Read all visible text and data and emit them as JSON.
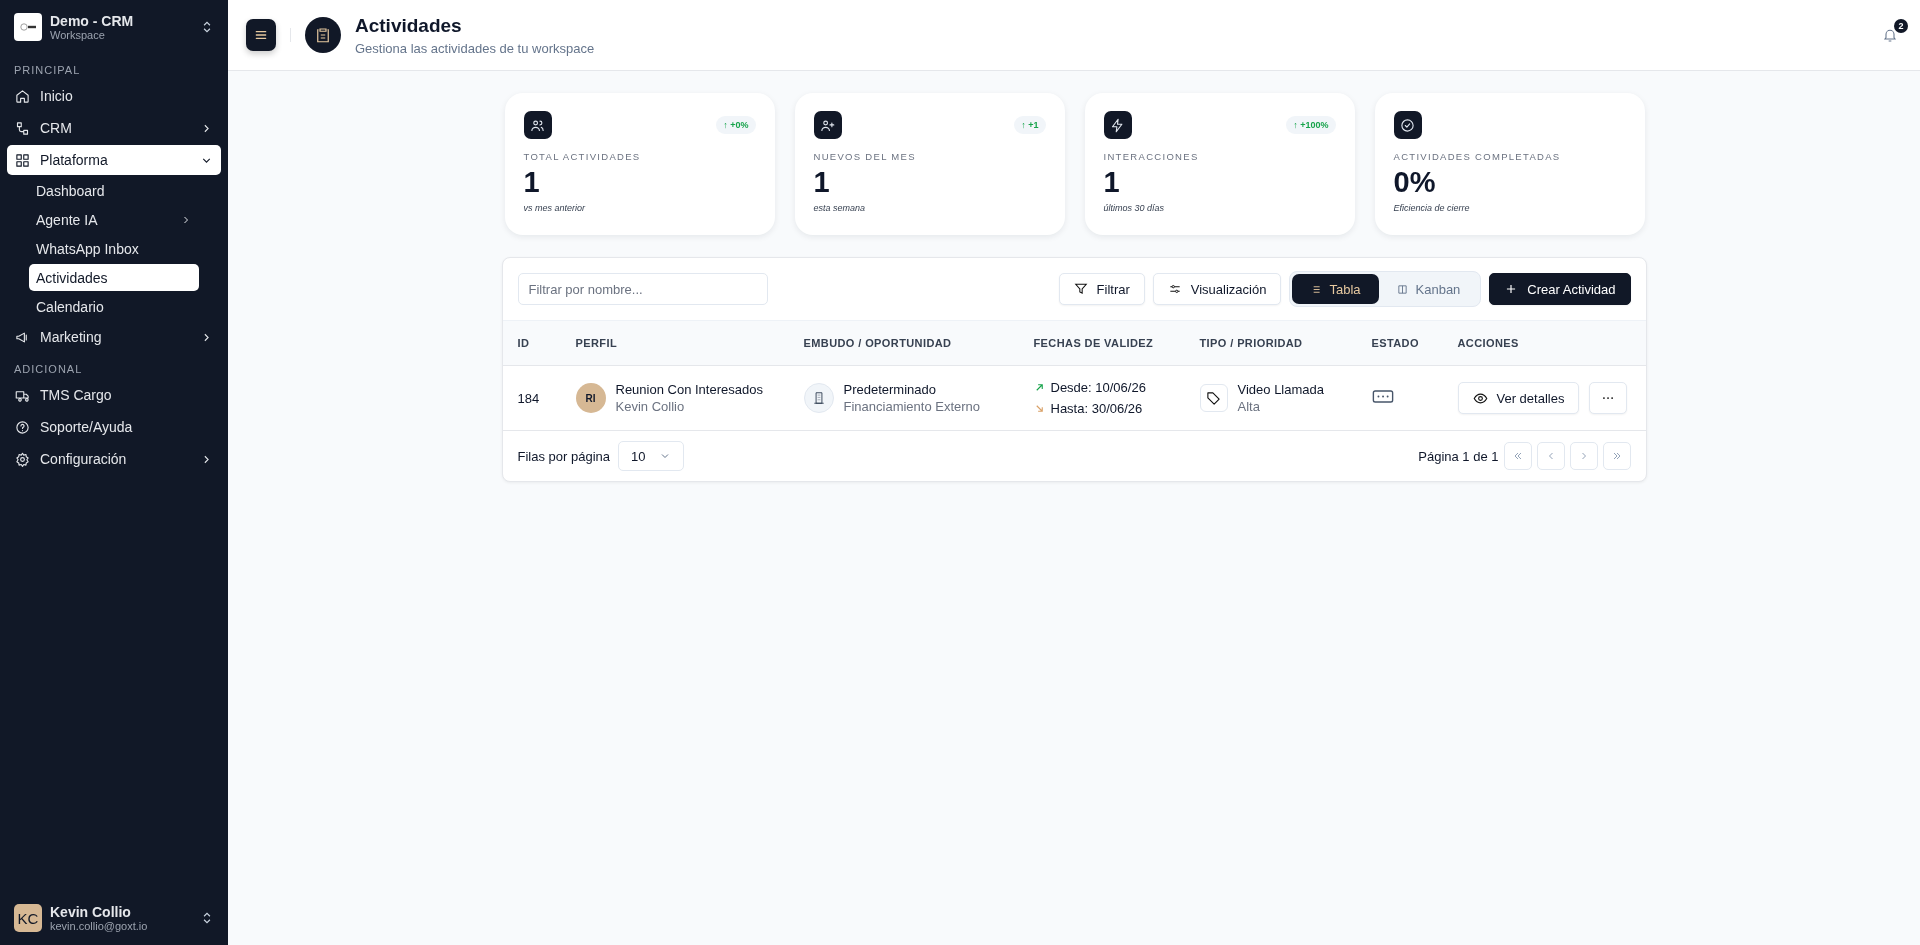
{
  "sidebar": {
    "workspace": {
      "name": "Demo - CRM",
      "sub": "Workspace"
    },
    "sections": [
      {
        "label": "PRINCIPAL",
        "items": [
          {
            "label": "Inicio",
            "selected": false
          },
          {
            "label": "CRM",
            "selected": false,
            "expanded": false
          },
          {
            "label": "Plataforma",
            "selected": true,
            "expanded": true,
            "children": [
              {
                "label": "Dashboard",
                "selected": false
              },
              {
                "label": "Agente IA",
                "selected": false,
                "expanded": false
              },
              {
                "label": "WhatsApp Inbox",
                "selected": false
              },
              {
                "label": "Actividades",
                "selected": true
              },
              {
                "label": "Calendario",
                "selected": false
              }
            ]
          },
          {
            "label": "Marketing",
            "selected": false,
            "expanded": false
          }
        ]
      },
      {
        "label": "ADICIONAL",
        "items": [
          {
            "label": "TMS Cargo",
            "selected": false
          },
          {
            "label": "Soporte/Ayuda",
            "selected": false
          },
          {
            "label": "Configuración",
            "selected": false,
            "expanded": false
          }
        ]
      }
    ],
    "user": {
      "initials": "KC",
      "name": "Kevin Collio",
      "email": "kevin.collio@goxt.io"
    }
  },
  "header": {
    "title": "Actividades",
    "subtitle": "Gestiona las actividades de tu workspace",
    "notifications": "2"
  },
  "stats": [
    {
      "badge": "↑ +0%",
      "label": "TOTAL ACTIVIDADES",
      "value": "1",
      "note": "vs mes anterior"
    },
    {
      "badge": "↑ +1",
      "label": "NUEVOS DEL MES",
      "value": "1",
      "note": "esta semana"
    },
    {
      "badge": "↑ +100%",
      "label": "INTERACCIONES",
      "value": "1",
      "note": "últimos 30 días"
    },
    {
      "label": "ACTIVIDADES COMPLETADAS",
      "value": "0%",
      "note": "Eficiencia de cierre"
    }
  ],
  "toolbar": {
    "search": {
      "placeholder": "Filtrar por nombre..."
    },
    "filter": "Filtrar",
    "view": "Visualización",
    "views": [
      {
        "label": "Tabla",
        "selected": true
      },
      {
        "label": "Kanban",
        "selected": false
      }
    ],
    "create": "Crear Actividad"
  },
  "table": {
    "columns": [
      "ID",
      "PERFIL",
      "EMBUDO / OPORTUNIDAD",
      "FECHAS DE VALIDEZ",
      "TIPO / PRIORIDAD",
      "ESTADO",
      "ACCIONES"
    ],
    "rows": [
      {
        "id": "184",
        "profile": {
          "initials": "RI",
          "name": "Reunion Con Interesados",
          "sub": "Kevin Collio"
        },
        "funnel": {
          "name": "Predeterminado",
          "sub": "Financiamiento Externo"
        },
        "dates": [
          {
            "kind": "start",
            "text": "Desde: 10/06/26"
          },
          {
            "kind": "end",
            "text": "Hasta: 30/06/26"
          }
        ],
        "type": {
          "name": "Video Llamada",
          "priority": "Alta"
        },
        "action": "Ver detalles"
      }
    ]
  },
  "footer": {
    "rows_label": "Filas por página",
    "rows_value": "10",
    "page": "Página 1 de 1"
  }
}
